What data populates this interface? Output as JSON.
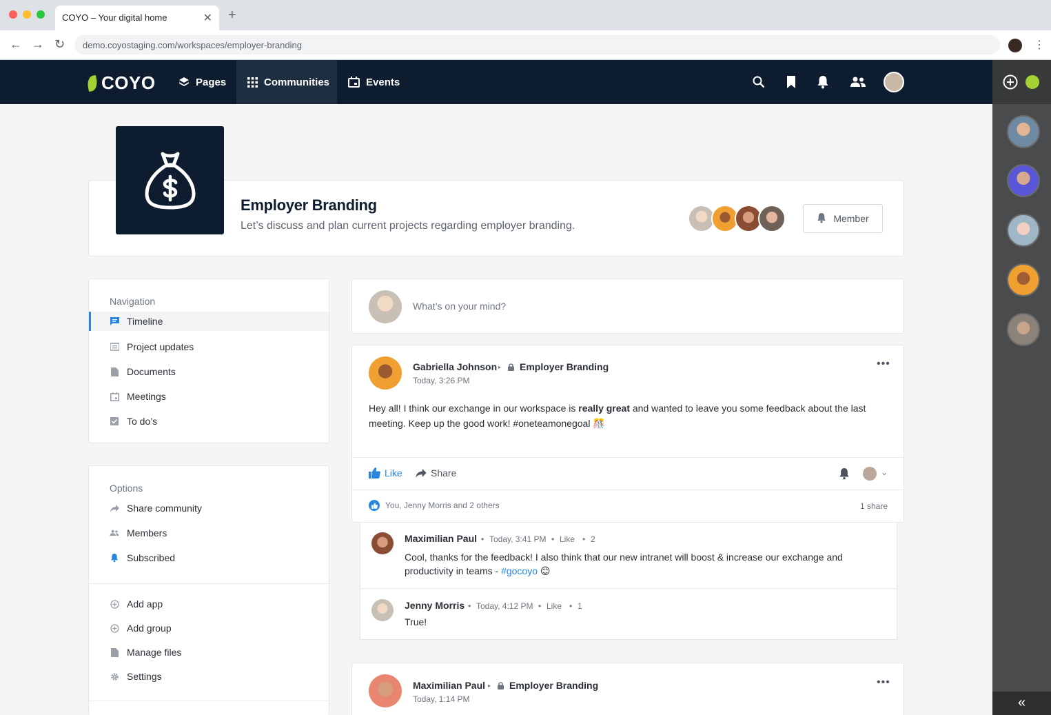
{
  "browser": {
    "tab_title": "COYO – Your digital home",
    "url": "demo.coyostaging.com/workspaces/employer-branding",
    "close_glyph": "✕",
    "new_tab_glyph": "+",
    "back_glyph": "←",
    "forward_glyph": "→",
    "reload_glyph": "↻",
    "menu_glyph": "⋮"
  },
  "topnav": {
    "logo_text": "COYO",
    "items": [
      {
        "label": "Pages",
        "icon": "layers-icon"
      },
      {
        "label": "Communities",
        "icon": "grid-icon",
        "active": true
      },
      {
        "label": "Events",
        "icon": "calendar-icon"
      }
    ],
    "icons": [
      "search-icon",
      "bookmark-icon",
      "bell-icon",
      "people-icon"
    ],
    "brand_color": "#0e1c2f",
    "accent_color": "#a4d233"
  },
  "workspace": {
    "title": "Employer Branding",
    "description": "Let’s discuss and plan current projects regarding employer branding.",
    "member_button": "Member",
    "icon": "money-bag-icon"
  },
  "navigation": {
    "heading": "Navigation",
    "items": [
      {
        "label": "Timeline",
        "icon": "chat-icon",
        "active": true
      },
      {
        "label": "Project updates",
        "icon": "news-icon"
      },
      {
        "label": "Documents",
        "icon": "document-icon"
      },
      {
        "label": "Meetings",
        "icon": "calendar-icon"
      },
      {
        "label": "To do’s",
        "icon": "checkbox-icon"
      }
    ]
  },
  "options": {
    "heading": "Options",
    "items": [
      {
        "label": "Share community",
        "icon": "share-icon"
      },
      {
        "label": "Members",
        "icon": "people-icon"
      },
      {
        "label": "Subscribed",
        "icon": "bell-icon"
      }
    ],
    "admin_items": [
      {
        "label": "Add app",
        "icon": "plus-circle-icon"
      },
      {
        "label": "Add group",
        "icon": "plus-circle-icon"
      },
      {
        "label": "Manage files",
        "icon": "document-icon"
      },
      {
        "label": "Settings",
        "icon": "gear-icon"
      }
    ]
  },
  "composer": {
    "placeholder": "What’s on your mind?"
  },
  "post": {
    "author": "Gabriella Johnson",
    "group": "Employer Branding",
    "time": "Today, 3:26 PM",
    "more_glyph": "•••",
    "body_before": "Hey all! I think our exchange in our workspace is ",
    "body_bold": "really great",
    "body_after": " and wanted to leave you some feedback about the last meeting. Keep up the good work! #oneteamonegoal ",
    "body_emoji": "🎊",
    "like_label": "Like",
    "share_label": "Share",
    "likes_text": "You, Jenny Morris and 2 others",
    "shares_text": "1 share",
    "chevron_glyph": "⌄"
  },
  "comments": [
    {
      "author": "Maximilian Paul",
      "time": "Today, 3:41 PM",
      "like": "Like",
      "count": "2",
      "text_before": "Cool, thanks for the feedback! I also think that our new intranet will boost & increase our exchange and productivity in teams - ",
      "hashtag": "#gocoyo",
      "emoji": "😊"
    },
    {
      "author": "Jenny Morris",
      "time": "Today, 4:12 PM",
      "like": "Like",
      "count": "1",
      "text_before": "True!",
      "hashtag": "",
      "emoji": ""
    }
  ],
  "post2": {
    "author": "Maximilian Paul",
    "group": "Employer Branding",
    "time": "Today, 1:14 PM",
    "more_glyph": "•••"
  },
  "meta": {
    "separator_dot": "•",
    "arrow_glyph": "▸",
    "collapse_glyph": "«"
  }
}
